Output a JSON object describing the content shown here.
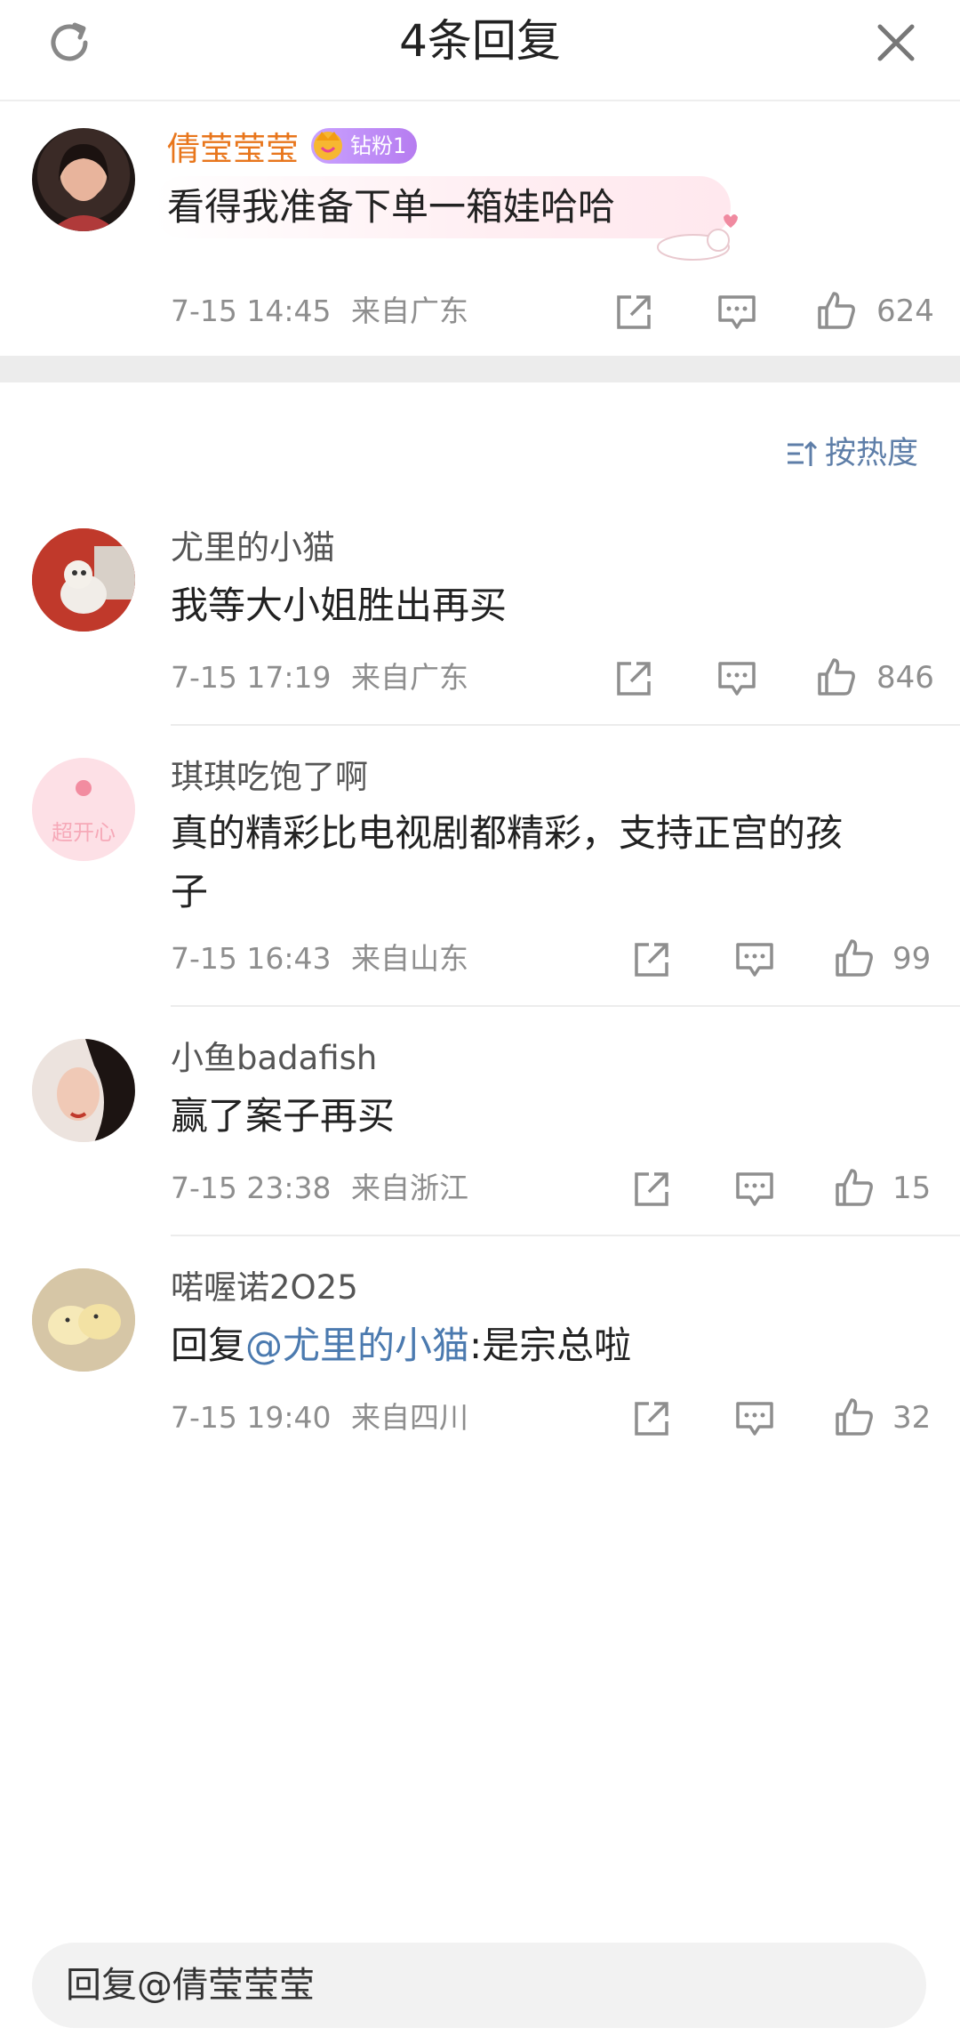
{
  "header": {
    "title": "4条回复",
    "refresh_icon": "refresh-icon",
    "close_icon": "close-icon"
  },
  "root_comment": {
    "user": "倩莹莹莹",
    "badge": "钻粉1",
    "text": "看得我准备下单一箱娃哈哈",
    "time": "7-15 14:45",
    "location": "来自广东",
    "likes": "624",
    "name_color": "#e8761c"
  },
  "sort": {
    "label": "按热度"
  },
  "replies": [
    {
      "user": "尤里的小猫",
      "text": "我等大小姐胜出再买",
      "time": "7-15 17:19",
      "location": "来自广东",
      "likes": "846"
    },
    {
      "user": "琪琪吃饱了啊",
      "text_line1": "真的精彩比电视剧都精彩，支持正宫的孩",
      "text_line2": "子",
      "time": "7-15 16:43",
      "location": "来自山东",
      "likes": "99"
    },
    {
      "user": "小鱼badafish",
      "text": "赢了案子再买",
      "time": "7-15 23:38",
      "location": "来自浙江",
      "likes": "15"
    },
    {
      "user": "喏喔诺2O25",
      "reply_prefix": "回复",
      "mention": "@尤里的小猫",
      "text": ":是宗总啦",
      "time": "7-15 19:40",
      "location": "来自四川",
      "likes": "32"
    }
  ],
  "reply_bar": {
    "placeholder": "回复@倩莹莹莹"
  },
  "avatar2_text": "超开心"
}
